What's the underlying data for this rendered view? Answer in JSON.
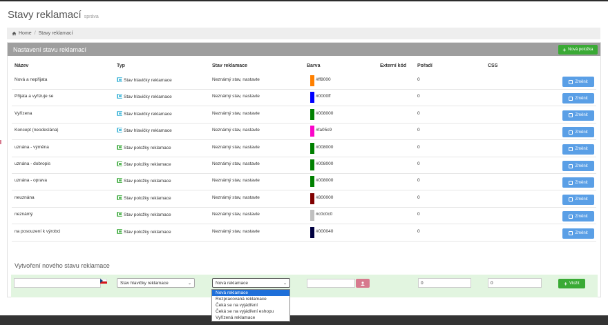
{
  "header": {
    "title": "Stavy reklamací",
    "subtitle": "správa"
  },
  "breadcrumb": {
    "home": "Home",
    "current": "Stavy reklamací"
  },
  "panel": {
    "title": "Nastavení stavu reklamací",
    "new_button": "Nová položka"
  },
  "table": {
    "columns": {
      "name": "Název",
      "type": "Typ",
      "state": "Stav reklamace",
      "color": "Barva",
      "external": "Externí kód",
      "order": "Pořadí",
      "css": "CSS"
    },
    "edit_label": "Změnit",
    "rows": [
      {
        "name": "Nová a nepřijata",
        "type": "Stav hlavičky reklamace",
        "type_kind": "head",
        "state": "Neznámý stav, nastavte",
        "color": "#ff8000",
        "order": "0"
      },
      {
        "name": "Přijata a vyřizuje se",
        "type": "Stav hlavičky reklamace",
        "type_kind": "head",
        "state": "Neznámý stav, nastavte",
        "color": "#0000ff",
        "order": "0"
      },
      {
        "name": "Vyřízena",
        "type": "Stav hlavičky reklamace",
        "type_kind": "head",
        "state": "Neznámý stav, nastavte",
        "color": "#008000",
        "order": "0"
      },
      {
        "name": "Koncept (neodeslána)",
        "type": "Stav hlavičky reklamace",
        "type_kind": "head",
        "state": "Neznámý stav, nastavte",
        "color": "#fa05c9",
        "order": "0"
      },
      {
        "name": "uznána - výměna",
        "type": "Stav položky reklamace",
        "type_kind": "item",
        "state": "Neznámý stav, nastavte",
        "color": "#008000",
        "order": "0"
      },
      {
        "name": "uznána - dobropis",
        "type": "Stav položky reklamace",
        "type_kind": "item",
        "state": "Neznámý stav, nastavte",
        "color": "#008000",
        "order": "0"
      },
      {
        "name": "uznána - oprava",
        "type": "Stav položky reklamace",
        "type_kind": "item",
        "state": "Neznámý stav, nastavte",
        "color": "#008000",
        "order": "0"
      },
      {
        "name": "neuznána",
        "type": "Stav položky reklamace",
        "type_kind": "item",
        "state": "Neznámý stav, nastavte",
        "color": "#800000",
        "order": "0"
      },
      {
        "name": "neznámý",
        "type": "Stav položky reklamace",
        "type_kind": "item",
        "state": "Neznámý stav, nastavte",
        "color": "#c0c0c0",
        "order": "0"
      },
      {
        "name": "na posouzení k výrobci",
        "type": "Stav položky reklamace",
        "type_kind": "item",
        "state": "Neznámý stav, nastavte",
        "color": "#000040",
        "order": "0"
      }
    ]
  },
  "create": {
    "title": "Vytvoření nového stavu reklamace",
    "name_value": "",
    "type_selected": "Stav hlavičky reklamace",
    "state_selected": "Nová reklamace",
    "state_options": [
      "Nová reklamace",
      "Rozpracovaná reklamace",
      "Čeká se na vyjádření",
      "Čeká se na vyjádření eshopu",
      "Vyřízená reklamace"
    ],
    "color_value": "",
    "order_value": "0",
    "css_value": "0",
    "add_label": "Vložit"
  }
}
